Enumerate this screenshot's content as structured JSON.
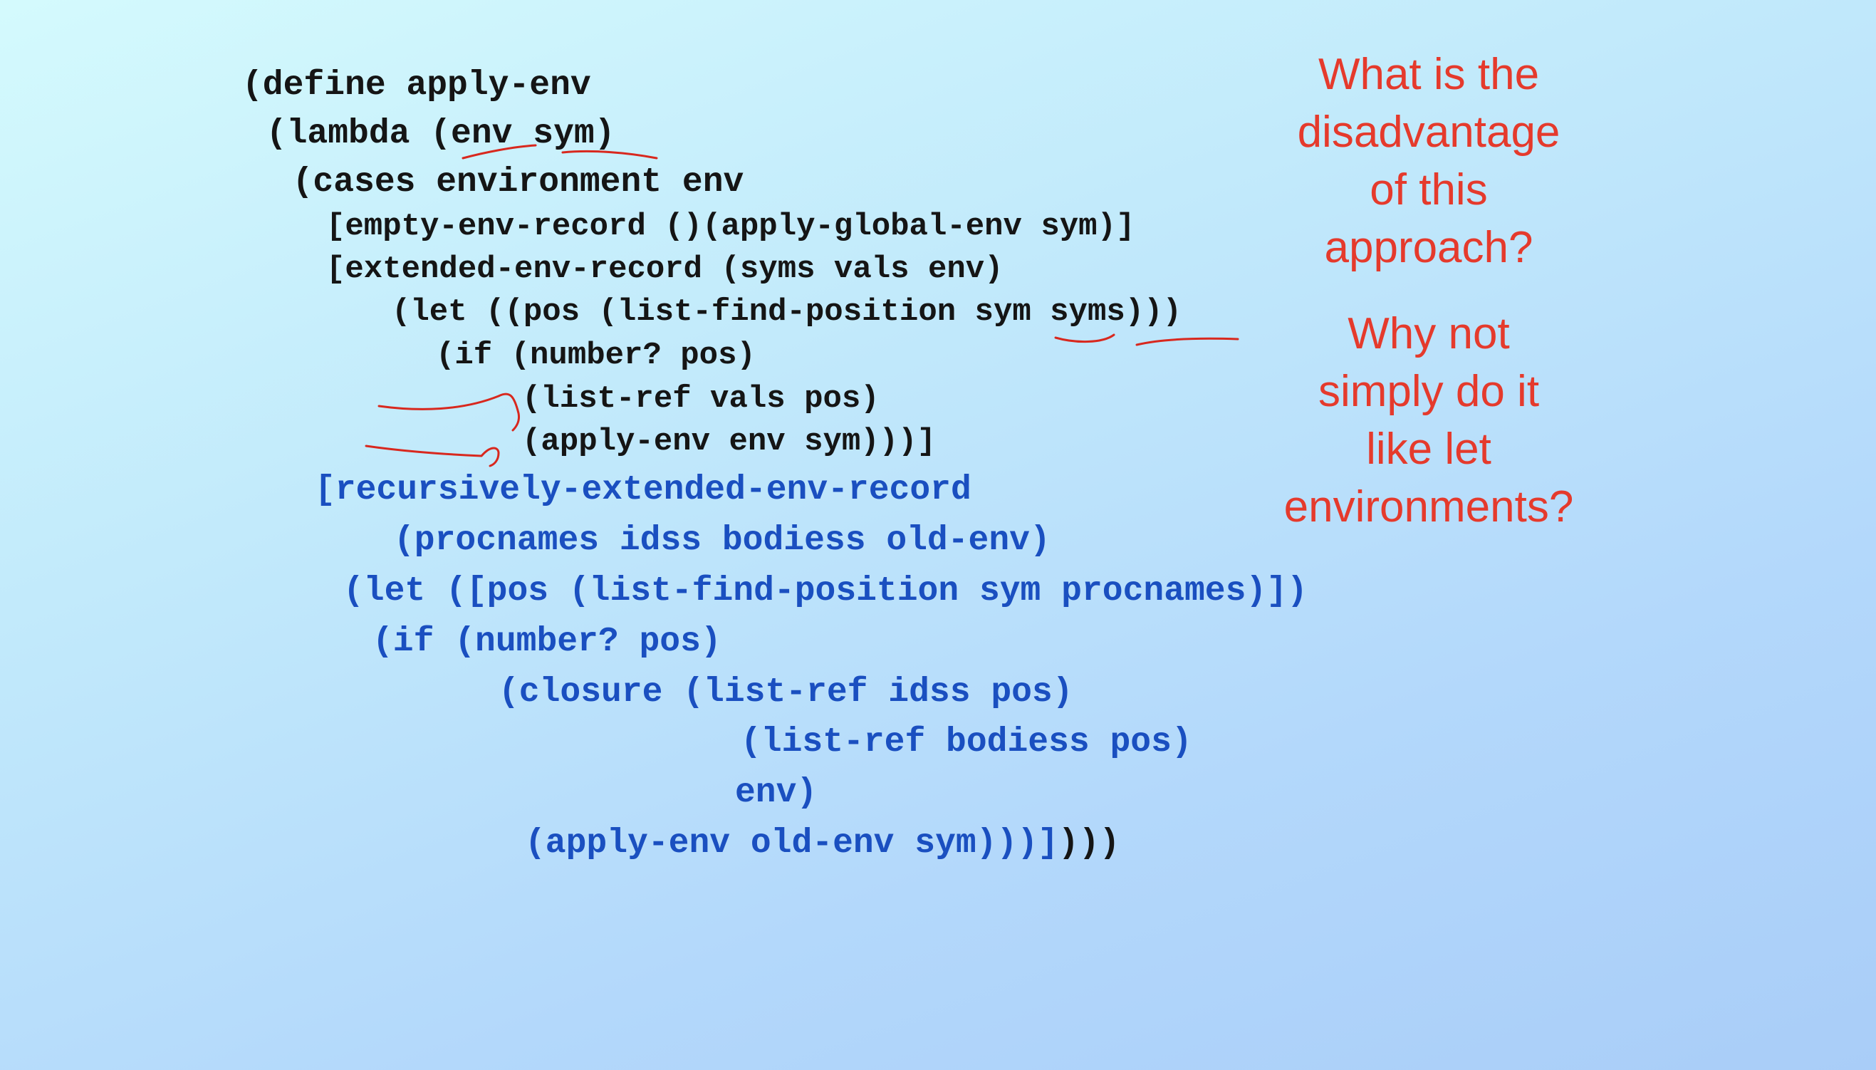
{
  "code": {
    "black": [
      "(define apply-env",
      " (lambda (env sym)",
      "  (cases environment env",
      "[empty-env-record ()(apply-global-env sym)]",
      "[extended-env-record (syms vals env)",
      "(let ((pos (list-find-position sym syms)))",
      "(if (number? pos)",
      "(list-ref vals pos)",
      "(apply-env env sym)))]"
    ],
    "blue": [
      "[recursively-extended-env-record",
      "(procnames idss bodiess old-env)",
      "(let ([pos (list-find-position sym procnames)])",
      "(if (number? pos)",
      "(closure (list-ref idss pos)",
      "(list-ref bodiess pos)",
      "env)",
      "(apply-env old-env sym)))]"
    ],
    "closing_black": ")))"
  },
  "questions": {
    "first": "What is the\ndisadvantage\nof this\napproach?",
    "second": "Why not\nsimply do it\nlike let\nenvironments?"
  },
  "colors": {
    "code_black": "#151515",
    "code_blue": "#1a4fc0",
    "question_red": "#e53a2c",
    "annotation_red": "#d8281e"
  }
}
